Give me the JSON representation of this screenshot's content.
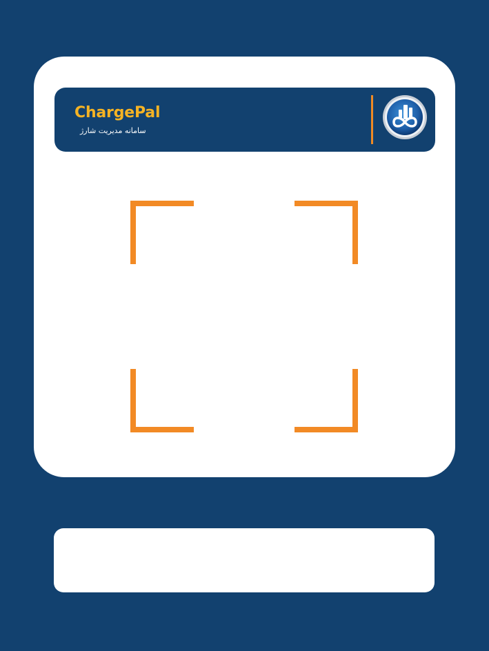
{
  "colors": {
    "background": "#12416f",
    "brand_text": "#f5b324",
    "accent": "#f08a24",
    "card": "#ffffff"
  },
  "header": {
    "brand_name": "ChargePal",
    "subtitle": "سامانه مدیریت شارژ",
    "logo_icon": "buildings-infinity-logo"
  },
  "scanner": {
    "frame_icon": "qr-scan-frame"
  },
  "bottom_panel": {
    "text": ""
  }
}
